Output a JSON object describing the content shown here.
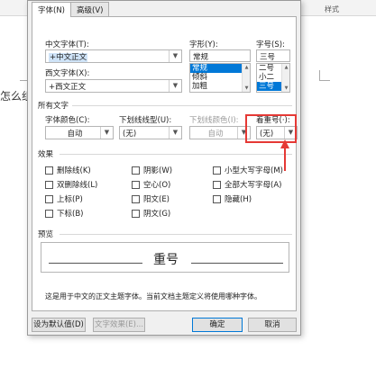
{
  "background": {
    "ribbon_label": "样式",
    "doc_text": "怎么组"
  },
  "dialog": {
    "tabs": [
      {
        "label": "字体(N)",
        "active": true
      },
      {
        "label": "高级(V)",
        "active": false
      }
    ],
    "chinese_font": {
      "label": "中文字体(T):",
      "value": "+中文正文"
    },
    "western_font": {
      "label": "西文字体(X):",
      "value": "+西文正文"
    },
    "style": {
      "label": "字形(Y):",
      "value": "常规",
      "options": [
        "常规",
        "倾斜",
        "加粗"
      ],
      "selected": "常规"
    },
    "size": {
      "label": "字号(S):",
      "value": "三号",
      "options": [
        "二号",
        "小二",
        "三号"
      ],
      "selected": "三号"
    },
    "all_text": {
      "title": "所有文字",
      "font_color": {
        "label": "字体颜色(C):",
        "value": "自动"
      },
      "underline_type": {
        "label": "下划线线型(U):",
        "value": "(无)"
      },
      "underline_color": {
        "label": "下划线颜色(I):",
        "value": "自动"
      },
      "emphasis": {
        "label": "着重号(·):",
        "value": "(无)"
      }
    },
    "effects": {
      "title": "效果",
      "items": [
        {
          "label": "删除线(K)"
        },
        {
          "label": "阴影(W)"
        },
        {
          "label": "小型大写字母(M)"
        },
        {
          "label": "双删除线(L)"
        },
        {
          "label": "空心(O)"
        },
        {
          "label": "全部大写字母(A)"
        },
        {
          "label": "上标(P)"
        },
        {
          "label": "阳文(E)"
        },
        {
          "label": "隐藏(H)"
        },
        {
          "label": "下标(B)"
        },
        {
          "label": "阴文(G)"
        }
      ]
    },
    "preview": {
      "title": "预览",
      "sample": "重号"
    },
    "description": "这是用于中文的正文主题字体。当前文档主题定义将使用哪种字体。",
    "buttons": {
      "set_default": "设为默认值(D)",
      "text_effects": "文字效果(E)...",
      "ok": "确定",
      "cancel": "取消"
    }
  },
  "colors": {
    "highlight": "#e53935",
    "selection": "#0078d7"
  }
}
